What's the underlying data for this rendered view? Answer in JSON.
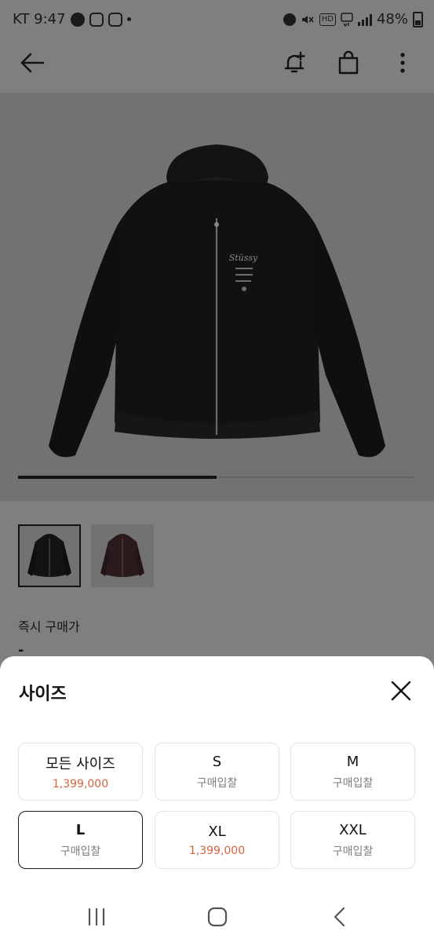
{
  "status_bar": {
    "carrier_time": "KT 9:47",
    "left_icons": [
      "talk-icon",
      "instagram-icon",
      "instagram-icon",
      "dot-icon"
    ],
    "right_icons": [
      "alarm-icon",
      "mute-icon",
      "hd-icon",
      "5g-icon",
      "signal-icon"
    ],
    "hd_label": "HD",
    "battery": "48%"
  },
  "header": {
    "icons": [
      "back-arrow-icon",
      "bell-plus-icon",
      "shopping-bag-icon",
      "more-vertical-icon"
    ]
  },
  "product": {
    "image": "black-hooded-work-jacket",
    "brand_print": "Stüssy",
    "carousel_progress": 0.5,
    "thumbnails": [
      {
        "name": "black-jacket",
        "color": "#151515",
        "selected": true
      },
      {
        "name": "brown-jacket",
        "color": "#2a1a1c",
        "selected": false
      }
    ]
  },
  "instant_buy": {
    "label": "즉시 구매가",
    "value": "-"
  },
  "size_sheet": {
    "title": "사이즈",
    "options": [
      {
        "size": "모든 사이즈",
        "sub": "1,399,000",
        "is_price": true,
        "selected": false
      },
      {
        "size": "S",
        "sub": "구매입찰",
        "is_price": false,
        "selected": false
      },
      {
        "size": "M",
        "sub": "구매입찰",
        "is_price": false,
        "selected": false
      },
      {
        "size": "L",
        "sub": "구매입찰",
        "is_price": false,
        "selected": true
      },
      {
        "size": "XL",
        "sub": "1,399,000",
        "is_price": true,
        "selected": false
      },
      {
        "size": "XXL",
        "sub": "구매입찰",
        "is_price": false,
        "selected": false
      }
    ]
  },
  "nav_bar": {
    "icons": [
      "recent-apps-icon",
      "home-icon",
      "nav-back-icon"
    ]
  },
  "colors": {
    "accent_price": "#d4633c",
    "dim_overlay": "#7f7f7f"
  }
}
